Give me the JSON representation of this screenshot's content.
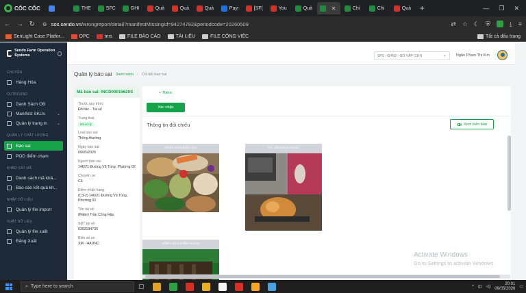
{
  "browser": {
    "name": "CỐC CỐC",
    "tabs": [
      {
        "label": "",
        "color": "#4285f4",
        "icon": "google-drive-icon"
      },
      {
        "label": "THE",
        "color": "#1e8e3e",
        "icon": "sheets-icon"
      },
      {
        "label": "SFC",
        "color": "#1e8e3e",
        "icon": "sheets-icon"
      },
      {
        "label": "GHI",
        "color": "#1e8e3e",
        "icon": "sheets-icon"
      },
      {
        "label": "Quả",
        "color": "#d93025",
        "icon": "sendo-icon"
      },
      {
        "label": "Quả",
        "color": "#d93025",
        "icon": "sendo-icon"
      },
      {
        "label": "Quả",
        "color": "#d93025",
        "icon": "sendo-icon"
      },
      {
        "label": "Payi",
        "color": "#1a73e8",
        "icon": "payment-icon"
      },
      {
        "label": "[SF(",
        "color": "#d93025",
        "icon": "sendo-icon"
      },
      {
        "label": "You",
        "color": "#d93025",
        "icon": "youtube-icon"
      },
      {
        "label": "Quả",
        "color": "#1e8e3e",
        "icon": "globe-icon"
      },
      {
        "label": "",
        "color": "#1e8e3e",
        "icon": "globe-icon",
        "active": true
      },
      {
        "label": "Chi",
        "color": "#1e8e3e",
        "icon": "globe-icon"
      },
      {
        "label": "Chi",
        "color": "#1e8e3e",
        "icon": "globe-icon"
      },
      {
        "label": "Quả",
        "color": "#d93025",
        "icon": "sendo-icon"
      }
    ],
    "url_host": "sos.sendo.vn",
    "url_path": "/wrongreport/detail?manifestMissingId=94274792&periodcode=20260509",
    "bookmarks": [
      "SenLight Case Platfor...",
      "OPC",
      "tms",
      "FILE BÁO CÁO",
      "TÀI LIỆU",
      "FILE CÔNG VIỆC"
    ],
    "bookmarks_right": "Tất cả dấu trang"
  },
  "sidebar": {
    "brand": "Sendo Farm Operation Systems",
    "sections": [
      {
        "title": "CHUYÊN",
        "items": [
          {
            "label": "Hàng Hóa",
            "chevron": false
          }
        ]
      },
      {
        "title": "OUTBOUND",
        "items": [
          {
            "label": "Danh Sách OB",
            "chevron": false
          },
          {
            "label": "Manifest SKUs",
            "chevron": true
          },
          {
            "label": "Quản lý trạng in",
            "chevron": true
          }
        ]
      },
      {
        "title": "QUẢN LÝ CHẤT LƯỢNG",
        "items": [
          {
            "label": "Báo sai",
            "chevron": false,
            "active": true
          },
          {
            "label": "POD điểm chạm",
            "chevron": false
          }
        ]
      },
      {
        "title": "KHẢO SÁT MÃ",
        "items": [
          {
            "label": "Danh sách mã khả...",
            "chevron": false
          },
          {
            "label": "Báo cáo kết quả kh...",
            "chevron": false
          }
        ]
      },
      {
        "title": "NHẬP DỮ LIỆU",
        "items": [
          {
            "label": "Quản lý file import",
            "chevron": false
          }
        ]
      },
      {
        "title": "XUẤT DỮ LIỆU",
        "items": [
          {
            "label": "Quản lý file xuất",
            "chevron": false
          },
          {
            "label": "Đăng Xuất",
            "chevron": false
          }
        ]
      }
    ]
  },
  "topbar": {
    "warehouse": "SFS - GHN2 - GÒ VẤP (11H)",
    "username": "Ngân Phạm Thị Kim"
  },
  "breadcrumb": {
    "title": "Quản lý báo sai",
    "link": "Danh sách",
    "current": "Chi tiết báo sai"
  },
  "info": {
    "code": "Mã báo sai: INCD00015620S",
    "fields": [
      {
        "label": "Thuộc quy trình:",
        "value": "Đối tác - Tài xế"
      },
      {
        "label": "Trạng thái:",
        "badge": "Đã xử lý"
      },
      {
        "label": "Loại báo sai:",
        "value": "Thông thường"
      },
      {
        "label": "Ngày báo sai:",
        "value": "09/05/2026"
      },
      {
        "label": "Người báo sai:",
        "value": "146/21 Đường Vũ Tùng, Phường 02"
      },
      {
        "label": "Chuyến xe:",
        "value": "C3"
      },
      {
        "label": "Điểm nhận hàng:",
        "value": "(C3-2) 146/21 Đường Vũ Tùng, Phường 02"
      },
      {
        "label": "Tên tài xế:",
        "value": "(Rider) Trần Công Hậu"
      },
      {
        "label": "SĐT tài xế:",
        "value": "0393184730"
      },
      {
        "label": "Biển số xe:",
        "value": "XM - HAUNC"
      }
    ]
  },
  "content": {
    "add_link": "+ Thêm",
    "confirm_button": "Xác nhận",
    "section_title": "Thông tin đối chiếu",
    "view_button": "Xem biên bản",
    "images": [
      {
        "caption": "HÌNH ẢNH BÁO SAI"
      },
      {
        "caption": "TÀI XẾ GIAO HÀNG"
      },
      {
        "caption": "HÌNH ẢNH KIỂM HÀNG"
      }
    ]
  },
  "watermark": {
    "line1": "Activate Windows",
    "line2": "Go to Settings to activate Windows."
  },
  "taskbar": {
    "search_placeholder": "Type here to search",
    "time": "20:01",
    "date": "09/05/2026",
    "apps": [
      "#e3a325",
      "#2ea043",
      "#d93025",
      "#e8b21e",
      "#f5f5f5",
      "#d93025",
      "#f5a623",
      "#4aa3df"
    ]
  },
  "colors": {
    "accent": "#16a34a",
    "sidebar_bg": "#1e2a3a"
  }
}
